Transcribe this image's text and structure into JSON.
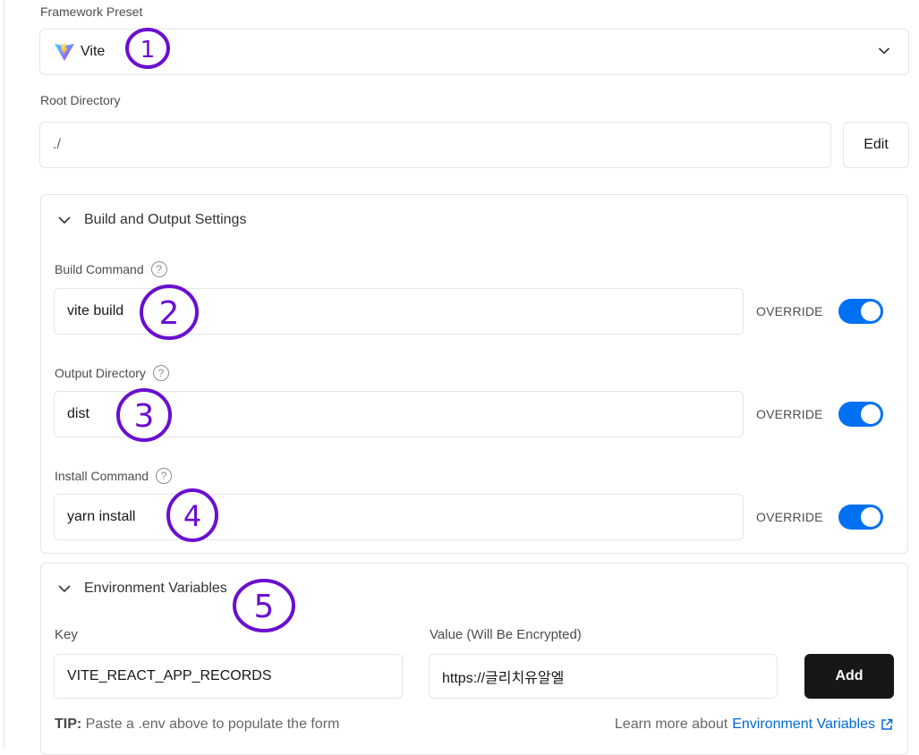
{
  "framework": {
    "label": "Framework Preset",
    "value": "Vite",
    "icon": "vite-logo-icon"
  },
  "root": {
    "label": "Root Directory",
    "value": "./",
    "edit_label": "Edit"
  },
  "build_section": {
    "title": "Build and Output Settings",
    "help_glyph": "?",
    "override_label": "OVERRIDE",
    "fields": [
      {
        "label": "Build Command",
        "value": "vite build",
        "override": true
      },
      {
        "label": "Output Directory",
        "value": "dist",
        "override": true
      },
      {
        "label": "Install Command",
        "value": "yarn install",
        "override": true
      }
    ]
  },
  "env_section": {
    "title": "Environment Variables",
    "key_label": "Key",
    "value_label": "Value (Will Be Encrypted)",
    "key_value": "VITE_REACT_APP_RECORDS",
    "value_value": "https://글리치유알엘",
    "add_label": "Add",
    "tip_label": "TIP:",
    "tip_text": "Paste a .env above to populate the form",
    "learn_text": "Learn more about",
    "learn_link": "Environment Variables"
  },
  "annotations": [
    "1",
    "2",
    "3",
    "4",
    "5"
  ],
  "colors": {
    "accent": "#0070f3",
    "link": "#0068d6",
    "annotation_ink": "#6a0fd0",
    "add_button": "#171717"
  }
}
